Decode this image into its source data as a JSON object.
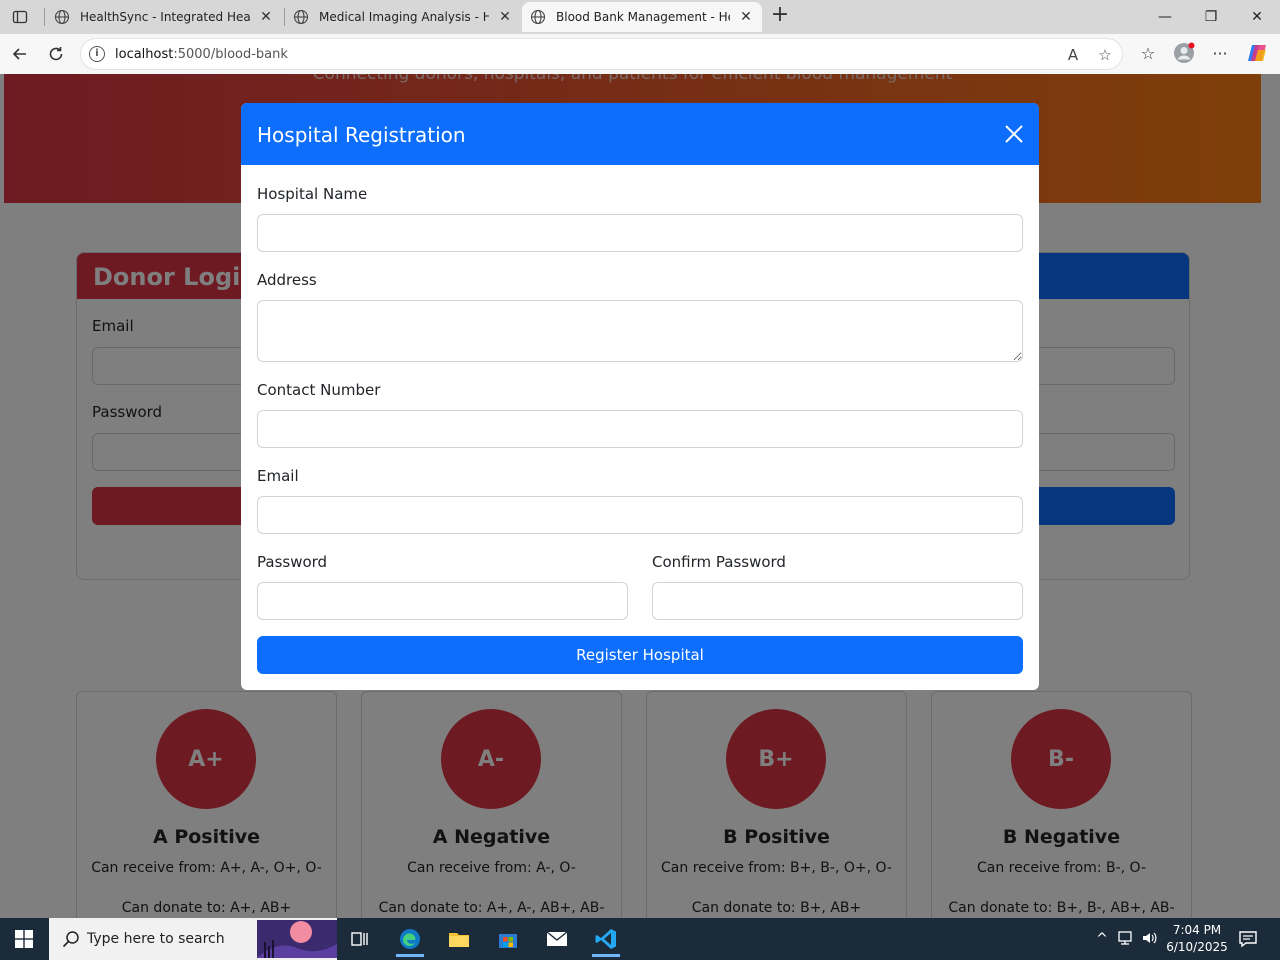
{
  "browser": {
    "tabs": [
      {
        "title": "HealthSync - Integrated Healthcare",
        "active": false
      },
      {
        "title": "Medical Imaging Analysis - HealthSync",
        "active": false
      },
      {
        "title": "Blood Bank Management - HealthSync",
        "active": true
      }
    ],
    "url_host": "localhost",
    "url_path": ":5000/blood-bank"
  },
  "page": {
    "hero_subtitle": "Connecting donors, hospitals, and patients for efficient blood management",
    "donor_login": {
      "title": "Donor Login",
      "email_label": "Email",
      "password_label": "Password"
    },
    "blood_groups": [
      {
        "symbol": "A+",
        "name": "A Positive",
        "receive": "Can receive from: A+, A-, O+, O-",
        "donate": "Can donate to: A+, AB+"
      },
      {
        "symbol": "A-",
        "name": "A Negative",
        "receive": "Can receive from: A-, O-",
        "donate": "Can donate to: A+, A-, AB+, AB-"
      },
      {
        "symbol": "B+",
        "name": "B Positive",
        "receive": "Can receive from: B+, B-, O+, O-",
        "donate": "Can donate to: B+, AB+"
      },
      {
        "symbol": "B-",
        "name": "B Negative",
        "receive": "Can receive from: B-, O-",
        "donate": "Can donate to: B+, B-, AB+, AB-"
      }
    ],
    "colors": {
      "primary": "#0d6efd",
      "danger": "#dc3545",
      "hero_end": "#fd7e14"
    }
  },
  "modal": {
    "title": "Hospital Registration",
    "hospital_name_label": "Hospital Name",
    "hospital_name_value": "",
    "address_label": "Address",
    "address_value": "",
    "contact_label": "Contact Number",
    "contact_value": "",
    "email_label": "Email",
    "email_value": "",
    "password_label": "Password",
    "password_value": "",
    "confirm_password_label": "Confirm Password",
    "confirm_password_value": "",
    "submit_label": "Register Hospital"
  },
  "taskbar": {
    "search_placeholder": "Type here to search",
    "time": "7:04 PM",
    "date": "6/10/2025"
  }
}
